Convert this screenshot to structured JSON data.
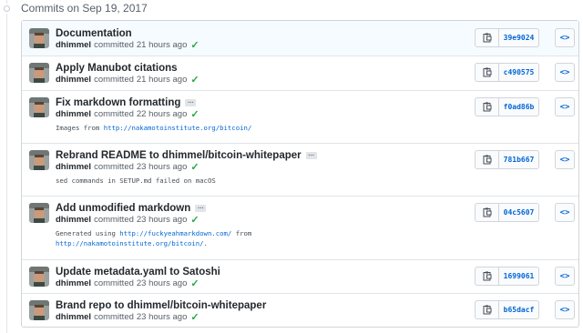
{
  "group": {
    "title": "Commits on Sep 19, 2017"
  },
  "commits": [
    {
      "title": "Documentation",
      "author": "dhimmel",
      "action": "committed",
      "time": "21 hours ago",
      "sha": "39e9024",
      "has_description": false
    },
    {
      "title": "Apply Manubot citations",
      "author": "dhimmel",
      "action": "committed",
      "time": "21 hours ago",
      "sha": "c490575",
      "has_description": false
    },
    {
      "title": "Fix markdown formatting",
      "author": "dhimmel",
      "action": "committed",
      "time": "22 hours ago",
      "sha": "f0ad86b",
      "has_description": true,
      "description": {
        "line1_text": "Images from ",
        "line1_link": "http://nakamotoinstitute.org/bitcoin/"
      }
    },
    {
      "title": "Rebrand README to dhimmel/bitcoin-whitepaper",
      "author": "dhimmel",
      "action": "committed",
      "time": "23 hours ago",
      "sha": "781b667",
      "has_description": true,
      "description": {
        "line1_text": "sed commands in SETUP.md failed on macOS"
      }
    },
    {
      "title": "Add unmodified markdown",
      "author": "dhimmel",
      "action": "committed",
      "time": "23 hours ago",
      "sha": "04c5607",
      "has_description": true,
      "description": {
        "line1_text": "Generated using ",
        "line1_link": "http://fuckyeahmarkdown.com/",
        "line1_after": " from",
        "line2_link": "http://nakamotoinstitute.org/bitcoin/",
        "line2_after": "."
      }
    },
    {
      "title": "Update metadata.yaml to Satoshi",
      "author": "dhimmel",
      "action": "committed",
      "time": "23 hours ago",
      "sha": "1699061",
      "has_description": false
    },
    {
      "title": "Brand repo to dhimmel/bitcoin-whitepaper",
      "author": "dhimmel",
      "action": "committed",
      "time": "23 hours ago",
      "sha": "b65dacf",
      "has_description": false
    }
  ],
  "icons": {
    "check": "check-icon",
    "clipboard": "clipboard-icon",
    "code": "code-icon",
    "ellipsis": "ellipsis-icon",
    "timeline": "commit-icon"
  },
  "labels": {
    "browse": "<>",
    "ellipsis": "…",
    "check": "✓"
  },
  "colors": {
    "link": "#0366d6",
    "success": "#28a745",
    "active_row": "#f6fbff"
  }
}
